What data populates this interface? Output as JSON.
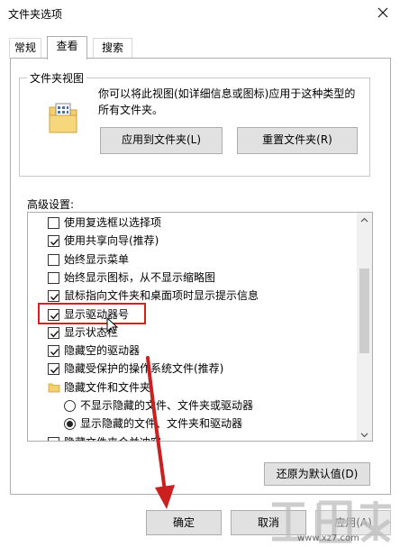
{
  "window": {
    "title": "文件夹选项",
    "close_icon": "close-icon"
  },
  "tabs": [
    {
      "label": "常规",
      "active": false
    },
    {
      "label": "查看",
      "active": true
    },
    {
      "label": "搜索",
      "active": false
    }
  ],
  "folder_views": {
    "caption": "文件夹视图",
    "description": "你可以将此视图(如详细信息或图标)应用于这种类型的所有文件夹。",
    "apply_button": "应用到文件夹(L)",
    "reset_button": "重置文件夹(R)",
    "icon": "folder-icon"
  },
  "advanced": {
    "label": "高级设置:",
    "items": [
      {
        "type": "checkbox",
        "checked": false,
        "label": "使用复选框以选择项"
      },
      {
        "type": "checkbox",
        "checked": true,
        "label": "使用共享向导(推荐)"
      },
      {
        "type": "checkbox",
        "checked": false,
        "label": "始终显示菜单"
      },
      {
        "type": "checkbox",
        "checked": false,
        "label": "始终显示图标，从不显示缩略图"
      },
      {
        "type": "checkbox",
        "checked": true,
        "label": "鼠标指向文件夹和桌面项时显示提示信息"
      },
      {
        "type": "checkbox",
        "checked": true,
        "label": "显示驱动器号"
      },
      {
        "type": "checkbox",
        "checked": true,
        "label": "显示状态栏"
      },
      {
        "type": "checkbox",
        "checked": true,
        "label": "隐藏空的驱动器"
      },
      {
        "type": "checkbox",
        "checked": true,
        "label": "隐藏受保护的操作系统文件(推荐)"
      },
      {
        "type": "folder",
        "label": "隐藏文件和文件夹"
      },
      {
        "type": "radio",
        "checked": false,
        "label": "不显示隐藏的文件、文件夹或驱动器"
      },
      {
        "type": "radio",
        "checked": true,
        "label": "显示隐藏的文件、文件夹和驱动器"
      },
      {
        "type": "checkbox",
        "checked": true,
        "label": "隐藏文件夹合并冲突"
      }
    ]
  },
  "buttons": {
    "restore_defaults": "还原为默认值(D)",
    "ok": "确定",
    "cancel": "取消",
    "apply": "应用(A)"
  },
  "watermark": {
    "url": "www.xz7.com"
  },
  "colors": {
    "highlight_border": "#d62020",
    "arrow": "#cc1f1f",
    "button_face": "#e1e1e1",
    "border": "#adadad"
  }
}
